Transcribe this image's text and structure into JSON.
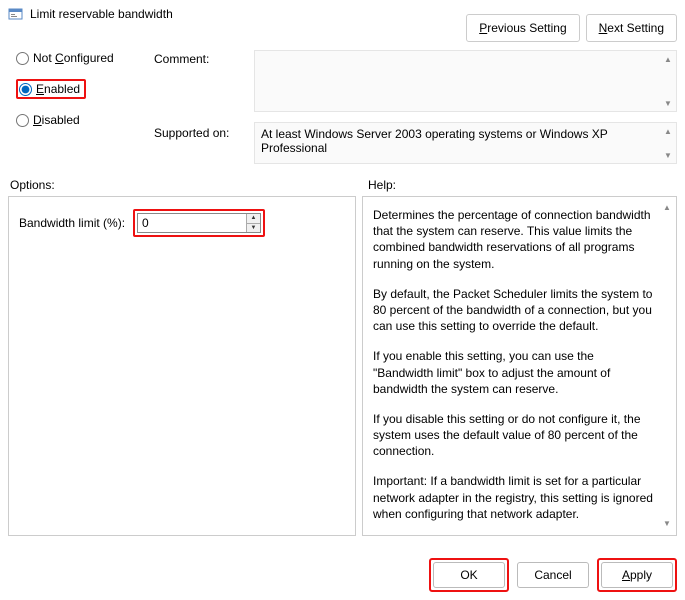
{
  "title": "Limit reservable bandwidth",
  "nav": {
    "previous": "Previous Setting",
    "next": "Next Setting"
  },
  "radios": {
    "not_configured": "Not Configured",
    "enabled": "Enabled",
    "disabled": "Disabled",
    "selected": "enabled"
  },
  "comment": {
    "label": "Comment:",
    "value": ""
  },
  "supported": {
    "label": "Supported on:",
    "value": "At least Windows Server 2003 operating systems or Windows XP Professional"
  },
  "options": {
    "label": "Options:",
    "bandwidth_label": "Bandwidth limit (%):",
    "bandwidth_value": "0"
  },
  "help": {
    "label": "Help:",
    "p1": "Determines the percentage of connection bandwidth that the system can reserve. This value limits the combined bandwidth reservations of all programs running on the system.",
    "p2": "By default, the Packet Scheduler limits the system to 80 percent of the bandwidth of a connection, but you can use this setting to override the default.",
    "p3": "If you enable this setting, you can use the \"Bandwidth limit\" box to adjust the amount of bandwidth the system can reserve.",
    "p4": "If you disable this setting or do not configure it, the system uses the default value of 80 percent of the connection.",
    "p5": "Important: If a bandwidth limit is set for a particular network adapter in the registry, this setting is ignored when configuring that network adapter."
  },
  "buttons": {
    "ok": "OK",
    "cancel": "Cancel",
    "apply": "Apply"
  }
}
